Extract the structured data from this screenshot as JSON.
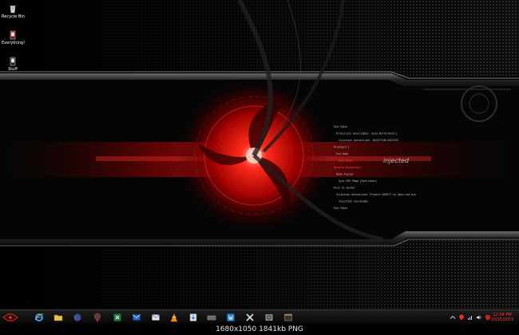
{
  "desktop": {
    "icons": [
      {
        "label": "Recycle Bin",
        "icon": "recycle-bin-icon"
      },
      {
        "label": "Everything!",
        "icon": "everything-app-icon"
      },
      {
        "label": "Stuff",
        "icon": "folder-shortcut-icon"
      }
    ]
  },
  "wallpaper": {
    "overlay_word": "injected",
    "code_lines": [
      "End Check",
      "Protection Overridden: Used Bufferhost()",
      "Injection Authorized: INJECTION.SUCCESS",
      "Prochost()",
      "End Hook",
      "End Check",
      "Resolve Bypassed()",
      "Hook Placed",
      "Sync BTS Page [Overrides]",
      "Aloc to Socket",
      "Injection Authorized: Prepare DIRECT to open.com.exe",
      "Injection Succeeded",
      "End Check"
    ],
    "colors": {
      "accent_red": "#d10a0a",
      "background": "#050505",
      "metal": "#5a5a5a"
    }
  },
  "taskbar": {
    "start": {
      "icon": "alienware-start-icon"
    },
    "pinned": [
      {
        "name": "internet-explorer",
        "icon": "internet-explorer-icon"
      },
      {
        "name": "file-explorer",
        "icon": "folder-icon"
      },
      {
        "name": "firefox",
        "icon": "firefox-icon"
      },
      {
        "name": "alienware-app",
        "icon": "alien-head-icon"
      },
      {
        "name": "excel",
        "icon": "excel-icon"
      },
      {
        "name": "outlook",
        "icon": "mail-icon"
      },
      {
        "name": "outlook-2",
        "icon": "envelope-icon"
      },
      {
        "name": "vlc",
        "icon": "vlc-cone-icon"
      },
      {
        "name": "utility",
        "icon": "download-icon"
      },
      {
        "name": "keyboard",
        "icon": "keyboard-icon"
      },
      {
        "name": "writer",
        "icon": "writer-icon"
      },
      {
        "name": "tools",
        "icon": "crossed-tools-icon"
      },
      {
        "name": "program",
        "icon": "gear-box-icon"
      },
      {
        "name": "terminal",
        "icon": "window-icon"
      }
    ],
    "tray_icons": [
      "chevron-up-icon",
      "alien-tray-icon",
      "network-icon",
      "volume-icon",
      "shield-tray-icon"
    ],
    "clock": {
      "time": "12:34 PM",
      "date": "10/15/2015"
    }
  },
  "caption": {
    "text": "1680x1050 1841kb PNG"
  }
}
